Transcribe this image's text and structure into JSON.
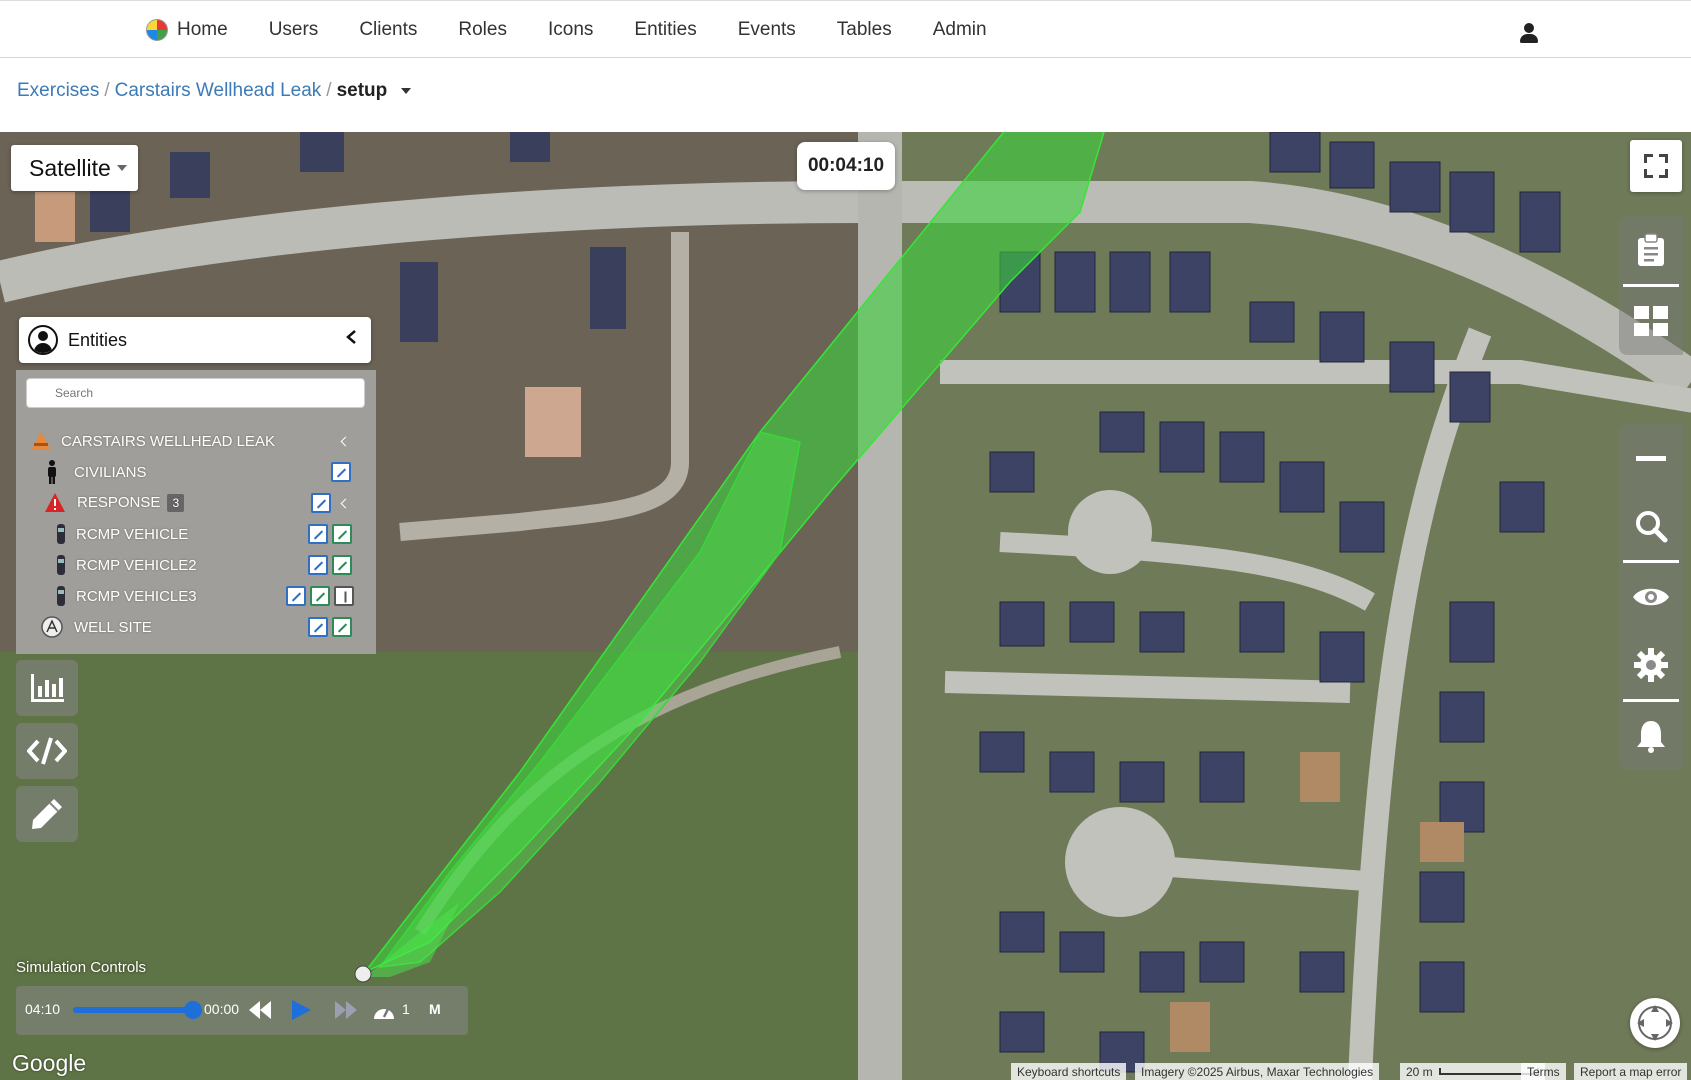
{
  "nav": {
    "home": "Home",
    "items": [
      "Users",
      "Clients",
      "Roles",
      "Icons",
      "Entities",
      "Events",
      "Tables",
      "Admin"
    ]
  },
  "breadcrumb": {
    "exercises": "Exercises",
    "exercise": "Carstairs Wellhead Leak",
    "current": "setup"
  },
  "map": {
    "type_label": "Satellite",
    "timer": "00:04:10",
    "attribution": {
      "shortcuts": "Keyboard shortcuts",
      "imagery": "Imagery ©2025 Airbus, Maxar Technologies",
      "scale": "20 m",
      "terms": "Terms",
      "report": "Report a map error"
    },
    "logo": "Google"
  },
  "entities": {
    "title": "Entities",
    "search_placeholder": "Search",
    "tree": {
      "root": "CARSTAIRS WELLHEAD LEAK",
      "civilians": "CIVILIANS",
      "response": "RESPONSE",
      "response_count": "3",
      "vehicle1": "RCMP VEHICLE",
      "vehicle2": "RCMP VEHICLE2",
      "vehicle3": "RCMP VEHICLE3",
      "well_site": "WELL SITE"
    }
  },
  "simulation": {
    "title": "Simulation Controls",
    "current_time": "04:10",
    "start_time": "00:00",
    "progress": 1.0,
    "speed": "1",
    "mode": "M"
  },
  "colors": {
    "plume": "#3cd23c",
    "link": "#3d7ab8",
    "slider": "#1e6fd9"
  }
}
